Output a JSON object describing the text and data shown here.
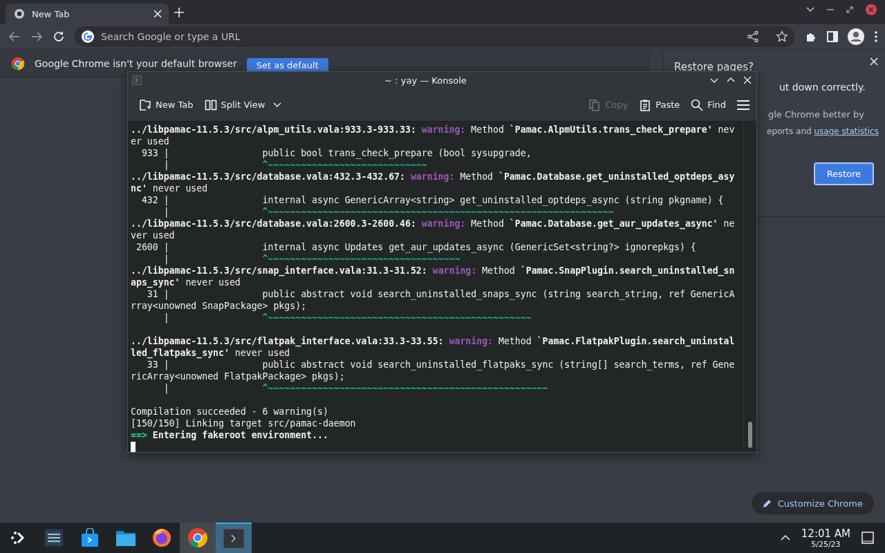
{
  "browser": {
    "tabs": [
      {
        "title": "New Tab",
        "selected": true
      }
    ],
    "omnibox": {
      "placeholder": "Search Google or type a URL"
    },
    "infobar": {
      "message": "Google Chrome isn't your default browser",
      "button": "Set as default"
    },
    "restore_bubble": {
      "title": "Restore pages?",
      "lines": [
        "ut down correctly.",
        "gle Chrome better by"
      ],
      "stats_prefix": "eports and ",
      "stats_link": "usage statistics",
      "button": "Restore"
    },
    "customize_button": "Customize Chrome"
  },
  "konsole": {
    "title": "~ : yay — Konsole",
    "toolbar": [
      {
        "kind": "new-tab",
        "label": "New Tab",
        "disabled": false
      },
      {
        "kind": "split",
        "label": "Split View",
        "disabled": false
      },
      {
        "kind": "copy",
        "label": "Copy",
        "disabled": true
      },
      {
        "kind": "paste",
        "label": "Paste",
        "disabled": false
      },
      {
        "kind": "find",
        "label": "Find",
        "disabled": false
      }
    ],
    "lines": [
      {
        "segments": [
          {
            "kind": "bold",
            "text": "../libpamac-11.5.3/src/alpm_utils.vala:933.3-933.33: "
          },
          {
            "kind": "warning",
            "text": "warning:"
          },
          {
            "kind": "plain",
            "text": " Method "
          },
          {
            "kind": "bold",
            "text": "`Pamac.AlpmUtils.trans_check_prepare'"
          },
          {
            "kind": "plain",
            "text": " nev"
          }
        ]
      },
      {
        "segments": [
          {
            "kind": "plain",
            "text": "er used"
          }
        ]
      },
      {
        "segments": [
          {
            "kind": "plain",
            "text": "  933 |                 public bool trans_check_prepare (bool sysupgrade,"
          }
        ]
      },
      {
        "segments": [
          {
            "kind": "plain",
            "text": "      |                 "
          },
          {
            "kind": "tilde",
            "text": "^~~~~~~~~~~~~~~~~~~~~~~~~~~~~~"
          }
        ]
      },
      {
        "segments": [
          {
            "kind": "bold",
            "text": "../libpamac-11.5.3/src/database.vala:432.3-432.67: "
          },
          {
            "kind": "warning",
            "text": "warning:"
          },
          {
            "kind": "plain",
            "text": " Method "
          },
          {
            "kind": "bold",
            "text": "`Pamac.Database.get_uninstalled_optdeps_asy"
          }
        ]
      },
      {
        "segments": [
          {
            "kind": "bold",
            "text": "nc'"
          },
          {
            "kind": "plain",
            "text": " never used"
          }
        ]
      },
      {
        "segments": [
          {
            "kind": "plain",
            "text": "  432 |                 internal async GenericArray<string> get_uninstalled_optdeps_async (string pkgname) {"
          }
        ]
      },
      {
        "segments": [
          {
            "kind": "plain",
            "text": "      |                 "
          },
          {
            "kind": "tilde",
            "text": "^~~~~~~~~~~~~~~~~~~~~~~~~~~~~~~~~~~~~~~~~~~~~~~~~~~~~~~~~~~~~~~~"
          }
        ]
      },
      {
        "segments": [
          {
            "kind": "bold",
            "text": "../libpamac-11.5.3/src/database.vala:2600.3-2600.46: "
          },
          {
            "kind": "warning",
            "text": "warning:"
          },
          {
            "kind": "plain",
            "text": " Method "
          },
          {
            "kind": "bold",
            "text": "`Pamac.Database.get_aur_updates_async'"
          },
          {
            "kind": "plain",
            "text": " ne"
          }
        ]
      },
      {
        "segments": [
          {
            "kind": "plain",
            "text": "ver used"
          }
        ]
      },
      {
        "segments": [
          {
            "kind": "plain",
            "text": " 2600 |                 internal async Updates get_aur_updates_async (GenericSet<string?> ignorepkgs) {"
          }
        ]
      },
      {
        "segments": [
          {
            "kind": "plain",
            "text": "      |                 "
          },
          {
            "kind": "tilde",
            "text": "^~~~~~~~~~~~~~~~~~~~~~~~~~~~~~~~~~~~"
          }
        ]
      },
      {
        "segments": [
          {
            "kind": "bold",
            "text": "../libpamac-11.5.3/src/snap_interface.vala:31.3-31.52: "
          },
          {
            "kind": "warning",
            "text": "warning:"
          },
          {
            "kind": "plain",
            "text": " Method "
          },
          {
            "kind": "bold",
            "text": "`Pamac.SnapPlugin.search_uninstalled_sn"
          }
        ]
      },
      {
        "segments": [
          {
            "kind": "bold",
            "text": "aps_sync'"
          },
          {
            "kind": "plain",
            "text": " never used"
          }
        ]
      },
      {
        "segments": [
          {
            "kind": "plain",
            "text": "   31 |                 public abstract void search_uninstalled_snaps_sync (string search_string, ref GenericA"
          }
        ]
      },
      {
        "segments": [
          {
            "kind": "plain",
            "text": "rray<unowned SnapPackage> pkgs);"
          }
        ]
      },
      {
        "segments": [
          {
            "kind": "plain",
            "text": "      |                 "
          },
          {
            "kind": "tilde",
            "text": "^~~~~~~~~~~~~~~~~~~~~~~~~~~~~~~~~~~~~~~~~~~~~~~~~"
          }
        ]
      },
      {
        "gap_before": true,
        "segments": [
          {
            "kind": "bold",
            "text": "../libpamac-11.5.3/src/flatpak_interface.vala:33.3-33.55: "
          },
          {
            "kind": "warning",
            "text": "warning:"
          },
          {
            "kind": "plain",
            "text": " Method "
          },
          {
            "kind": "bold",
            "text": "`Pamac.FlatpakPlugin.search_uninstal"
          }
        ]
      },
      {
        "segments": [
          {
            "kind": "bold",
            "text": "led_flatpaks_sync'"
          },
          {
            "kind": "plain",
            "text": " never used"
          }
        ]
      },
      {
        "segments": [
          {
            "kind": "plain",
            "text": "   33 |                 public abstract void search_uninstalled_flatpaks_sync (string[] search_terms, ref Gene"
          }
        ]
      },
      {
        "segments": [
          {
            "kind": "plain",
            "text": "ricArray<unowned FlatpakPackage> pkgs);"
          }
        ]
      },
      {
        "segments": [
          {
            "kind": "plain",
            "text": "      |                 "
          },
          {
            "kind": "tilde",
            "text": "^~~~~~~~~~~~~~~~~~~~~~~~~~~~~~~~~~~~~~~~~~~~~~~~~~~~"
          }
        ]
      },
      {
        "gap_before": true,
        "segments": [
          {
            "kind": "plain",
            "text": "Compilation succeeded - 6 warning(s)"
          }
        ]
      },
      {
        "segments": [
          {
            "kind": "plain",
            "text": "[150/150] Linking target src/pamac-daemon"
          }
        ]
      },
      {
        "segments": [
          {
            "kind": "prompt",
            "text": "==>"
          },
          {
            "kind": "bold",
            "text": " Entering fakeroot environment..."
          }
        ]
      }
    ]
  },
  "taskbar": {
    "apps": [
      {
        "kind": "launcher",
        "selected": false
      },
      {
        "kind": "settings",
        "selected": false
      },
      {
        "kind": "store",
        "selected": false
      },
      {
        "kind": "files",
        "selected": false
      },
      {
        "kind": "firefox",
        "selected": false
      },
      {
        "kind": "chrome",
        "selected": true
      },
      {
        "kind": "konsole",
        "selected": true
      }
    ],
    "time": "12:01 AM",
    "date": "5/25/23"
  }
}
